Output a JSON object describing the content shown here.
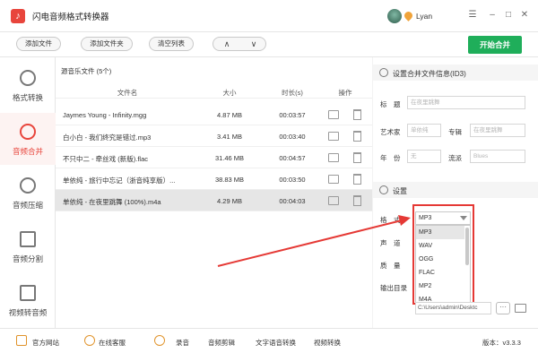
{
  "app": {
    "title": "闪电音频格式转换器",
    "username": "Lyan"
  },
  "toolbar": {
    "add_file": "添加文件",
    "add_folder": "添加文件夹",
    "clear_list": "清空列表",
    "up": "∧",
    "down": "∨",
    "start_merge": "开始合并"
  },
  "sidebar": {
    "items": [
      {
        "label": "格式转换",
        "icon": "refresh-icon"
      },
      {
        "label": "音频合并",
        "icon": "merge-icon",
        "active": true
      },
      {
        "label": "音频压缩",
        "icon": "music-note-icon"
      },
      {
        "label": "音频分割",
        "icon": "split-icon"
      },
      {
        "label": "视频转音频",
        "icon": "play-icon"
      }
    ]
  },
  "filelist": {
    "title": "源音乐文件 (5个)",
    "columns": [
      "文件名",
      "大小",
      "时长(s)",
      "操作"
    ],
    "rows": [
      {
        "name": "Jaymes Young - Infinity.mgg",
        "size": "4.87 MB",
        "duration": "00:03:57"
      },
      {
        "name": "白小白 - 我们终究是错过.mp3",
        "size": "3.41 MB",
        "duration": "00:03:40"
      },
      {
        "name": "不只中二 - 牵丝戏 (新版).flac",
        "size": "31.46 MB",
        "duration": "00:04:57"
      },
      {
        "name": "单依纯 - 旅行中忘记（浙音纯享版）...",
        "size": "38.83 MB",
        "duration": "00:03:50"
      },
      {
        "name": "单依纯 - 在夜里跳舞 (100%).m4a",
        "size": "4.29 MB",
        "duration": "00:04:03"
      }
    ]
  },
  "id3": {
    "title": "设置合并文件信息(ID3)",
    "fields": {
      "title_label": "标　题",
      "title_ph": "在夜里跳舞",
      "artist_label": "艺术家",
      "artist_ph": "单依纯",
      "album_label": "专辑",
      "album_ph": "在夜里跳舞",
      "year_label": "年　份",
      "year_ph": "无",
      "genre_label": "流派",
      "genre_ph": "Blues"
    }
  },
  "settings": {
    "title": "设置",
    "format_label": "格　式",
    "channel_label": "声　道",
    "quality_label": "质　量",
    "output_label": "输出目录",
    "format_value": "MP3",
    "format_options": [
      "MP3",
      "WAV",
      "OGG",
      "FLAC",
      "MP2",
      "M4A"
    ],
    "output_path": "C:\\Users\\admin\\Desktc",
    "more": "···"
  },
  "statusbar": {
    "website": "官方网站",
    "support": "在线客服",
    "record": "录音",
    "audio_cut": "音频剪辑",
    "tts": "文字语音转换",
    "video_convert": "视频转换",
    "version": "版本：v3.3.3"
  },
  "colors": {
    "accent": "#e8453c",
    "primary": "#1fae5a",
    "highlight": "#e53935"
  }
}
